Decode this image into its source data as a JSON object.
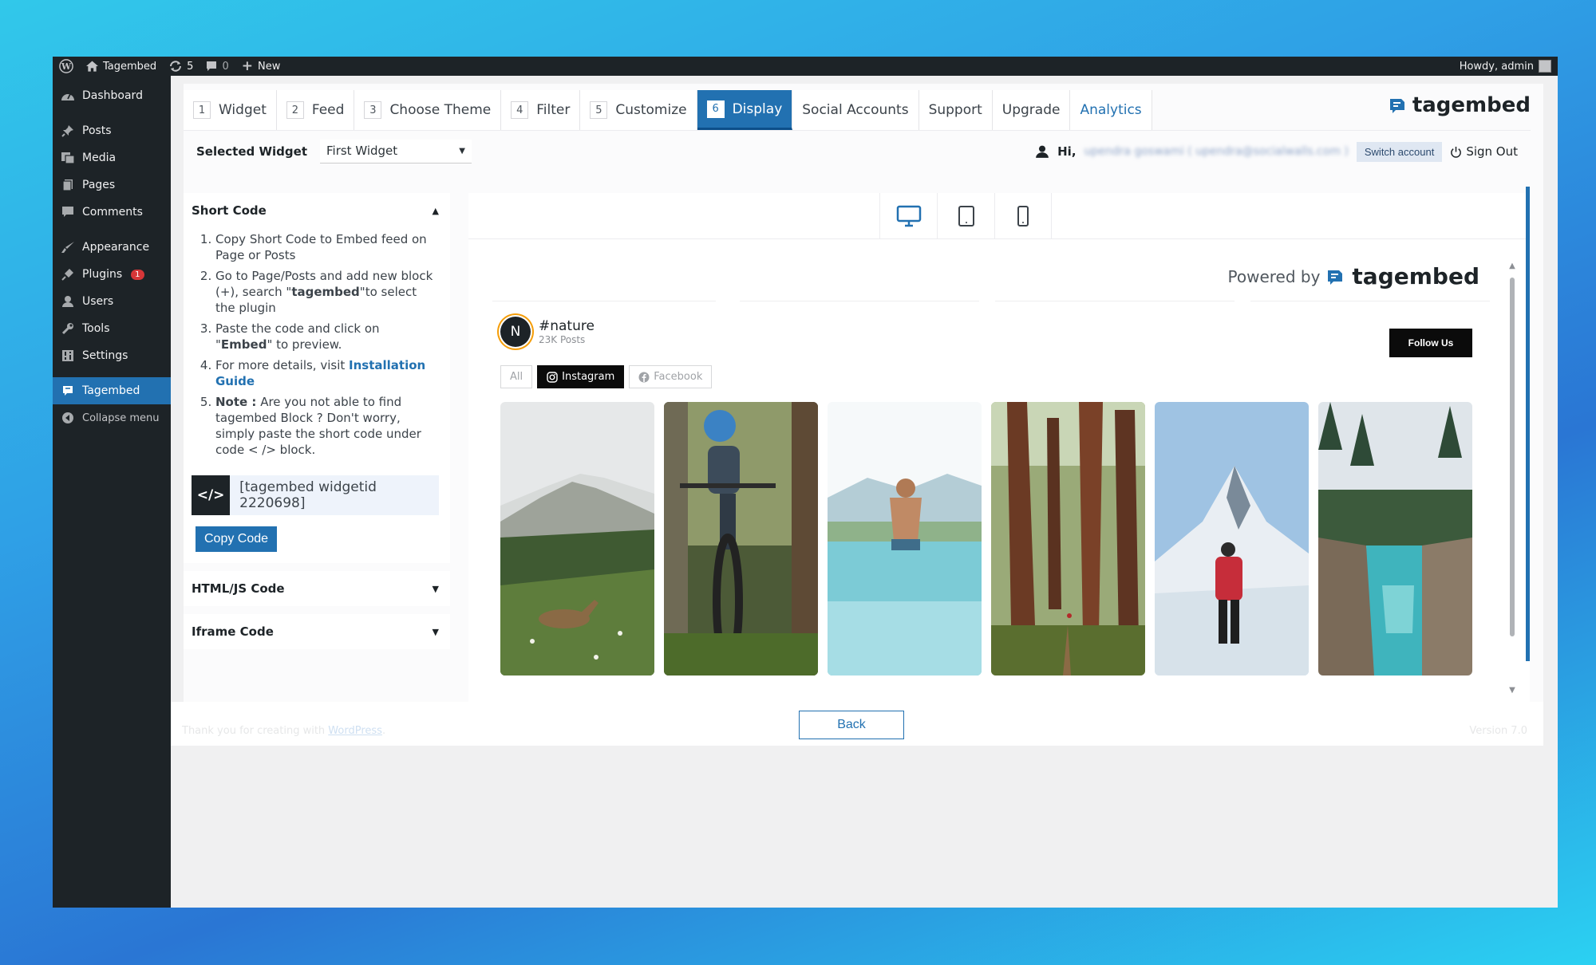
{
  "adminbar": {
    "site_name": "Tagembed",
    "updates_count": "5",
    "comments_count": "0",
    "new_label": "New",
    "howdy": "Howdy, admin"
  },
  "sidebar": {
    "items": [
      {
        "label": "Dashboard",
        "icon": "dashboard-icon"
      },
      {
        "label": "Posts",
        "icon": "pin-icon"
      },
      {
        "label": "Media",
        "icon": "media-icon"
      },
      {
        "label": "Pages",
        "icon": "pages-icon"
      },
      {
        "label": "Comments",
        "icon": "comment-icon"
      },
      {
        "label": "Appearance",
        "icon": "brush-icon"
      },
      {
        "label": "Plugins",
        "icon": "plug-icon",
        "badge": "1"
      },
      {
        "label": "Users",
        "icon": "user-icon"
      },
      {
        "label": "Tools",
        "icon": "wrench-icon"
      },
      {
        "label": "Settings",
        "icon": "settings-icon"
      },
      {
        "label": "Tagembed",
        "icon": "tagembed-icon"
      },
      {
        "label": "Collapse menu",
        "icon": "collapse-icon"
      }
    ]
  },
  "tabs": [
    {
      "num": "1",
      "label": "Widget"
    },
    {
      "num": "2",
      "label": "Feed"
    },
    {
      "num": "3",
      "label": "Choose Theme"
    },
    {
      "num": "4",
      "label": "Filter"
    },
    {
      "num": "5",
      "label": "Customize"
    },
    {
      "num": "6",
      "label": "Display"
    },
    {
      "label": "Social Accounts"
    },
    {
      "label": "Support"
    },
    {
      "label": "Upgrade"
    },
    {
      "label": "Analytics"
    }
  ],
  "brand": {
    "name": "tagembed",
    "accent": "#2271b1"
  },
  "widget_row": {
    "label": "Selected Widget",
    "selected": "First Widget",
    "hi": "Hi,",
    "user_blurred": "upendra goswami ( upendra@socialwalls.com )",
    "switch_account": "Switch account",
    "sign_out": "Sign Out"
  },
  "code_panel": {
    "short_code_title": "Short Code",
    "steps": {
      "s1": "Copy Short Code to Embed feed on Page or Posts",
      "s2a": "Go to Page/Posts and add new block (+), search \"",
      "s2b": "tagembed",
      "s2c": "\"to select the plugin",
      "s3a": "Paste the code and click on \"",
      "s3b": "Embed",
      "s3c": "\" to preview.",
      "s4a": "For more details, visit ",
      "s4b": "Installation Guide",
      "s5a": "Note :",
      "s5b": " Are you not able to find tagembed Block ? Don't worry, simply paste the short code under code < /> block."
    },
    "shortcode": "[tagembed widgetid 2220698]",
    "copy_label": "Copy Code",
    "html_js_title": "HTML/JS Code",
    "iframe_title": "Iframe Code"
  },
  "preview": {
    "powered_by": "Powered by",
    "brand": "tagembed",
    "feed_initial": "N",
    "feed_title": "#nature",
    "feed_count": "23K Posts",
    "follow_label": "Follow Us",
    "filters": [
      "All",
      "Instagram",
      "Facebook"
    ]
  },
  "footer": {
    "back_label": "Back",
    "thanks_prefix": "Thank you for creating with ",
    "thanks_link": "WordPress",
    "thanks_suffix": ".",
    "version": "Version 7.0"
  }
}
